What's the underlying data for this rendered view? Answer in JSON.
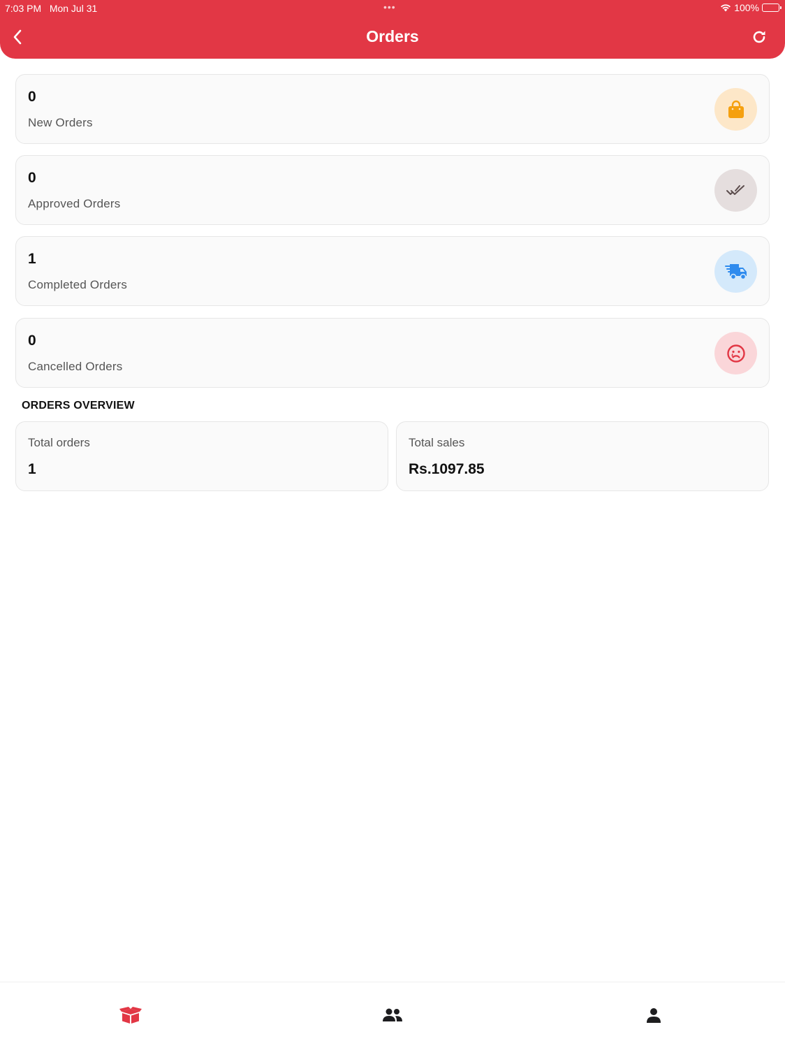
{
  "status_bar": {
    "time": "7:03 PM",
    "date": "Mon Jul 31",
    "battery": "100%"
  },
  "header": {
    "title": "Orders",
    "back_icon": "chevron-left-icon",
    "refresh_icon": "refresh-icon"
  },
  "stats": [
    {
      "count": "0",
      "label": "New Orders",
      "icon": "shopping-bag-icon",
      "icon_color": "#f5a00f",
      "icon_bg": "#fde7c8"
    },
    {
      "count": "0",
      "label": "Approved Orders",
      "icon": "double-check-icon",
      "icon_color": "#5c4d4d",
      "icon_bg": "#e5dede"
    },
    {
      "count": "1",
      "label": "Completed Orders",
      "icon": "delivery-truck-icon",
      "icon_color": "#2f8bee",
      "icon_bg": "#d4e9fb"
    },
    {
      "count": "0",
      "label": "Cancelled Orders",
      "icon": "sad-face-icon",
      "icon_color": "#e23745",
      "icon_bg": "#fad6d9"
    }
  ],
  "overview": {
    "title": "ORDERS OVERVIEW",
    "total_orders": {
      "label": "Total orders",
      "value": "1"
    },
    "total_sales": {
      "label": "Total sales",
      "value": "Rs.1097.85"
    }
  },
  "bottom_nav": [
    {
      "icon": "orders-box-icon",
      "active": true,
      "color": "#e23745"
    },
    {
      "icon": "customers-icon",
      "active": false,
      "color": "#1d1d1f"
    },
    {
      "icon": "profile-icon",
      "active": false,
      "color": "#1d1d1f"
    }
  ],
  "colors": {
    "brand": "#e23745"
  }
}
